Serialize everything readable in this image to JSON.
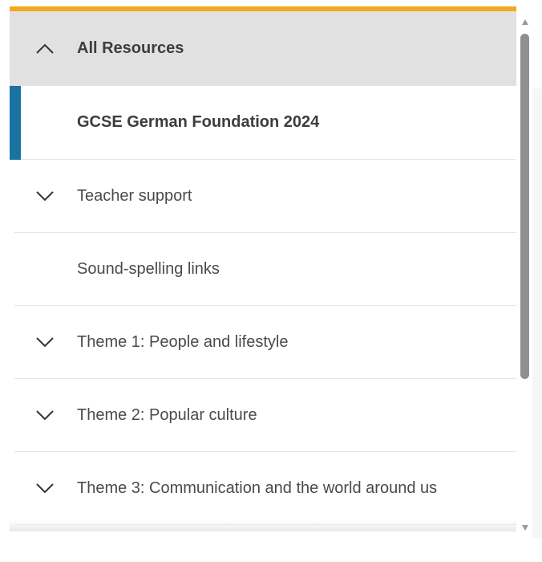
{
  "nav": {
    "header_label": "All Resources",
    "items": [
      {
        "label": "GCSE German Foundation 2024",
        "icon": "none",
        "active": true
      },
      {
        "label": "Teacher support",
        "icon": "chevron-down-icon"
      },
      {
        "label": "Sound-spelling links",
        "icon": "none"
      },
      {
        "label": "Theme 1: People and lifestyle",
        "icon": "chevron-down-icon"
      },
      {
        "label": "Theme 2: Popular culture",
        "icon": "chevron-down-icon"
      },
      {
        "label": "Theme 3: Communication and the world around us",
        "icon": "chevron-down-icon"
      }
    ]
  },
  "colors": {
    "accent_top": "#f5a81c",
    "active_marker": "#1a73a3",
    "header_bg": "#e1e1e1"
  }
}
